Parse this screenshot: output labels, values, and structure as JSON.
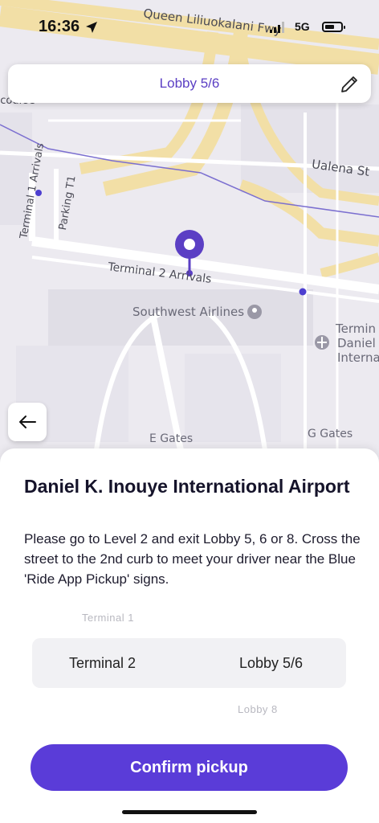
{
  "status": {
    "time": "16:36",
    "network": "5G"
  },
  "map": {
    "labels": {
      "queen": "Queen Liliuokalani Fwy",
      "ualena": "Ualena St",
      "terminal1_arrivals": "Terminal 1 Arrivals",
      "parking": "Parking T1",
      "terminal2_arrivals": "Terminal 2 Arrivals",
      "southwest": "Southwest Airlines",
      "concourse": "ncourse",
      "terminal_right1": "Termin",
      "terminal_right2": "Daniel I",
      "terminal_right3": "Interna",
      "e_gates": "E Gates",
      "g_gates": "G Gates"
    },
    "accent": "#5b3fc4"
  },
  "top_card": {
    "label": "Lobby 5/6"
  },
  "sheet": {
    "title": "Daniel K. Inouye International Airport",
    "description": "Please go to Level 2 and exit Lobby 5, 6 or 8. Cross the street to the 2nd curb to meet your driver near the Blue 'Ride App Pickup' signs.",
    "picker": {
      "above": "Terminal 1",
      "selected_terminal": "Terminal 2",
      "selected_lobby": "Lobby 5/6",
      "below": "Lobby 8"
    },
    "confirm_label": "Confirm pickup",
    "button_color": "#5a3cd8"
  }
}
